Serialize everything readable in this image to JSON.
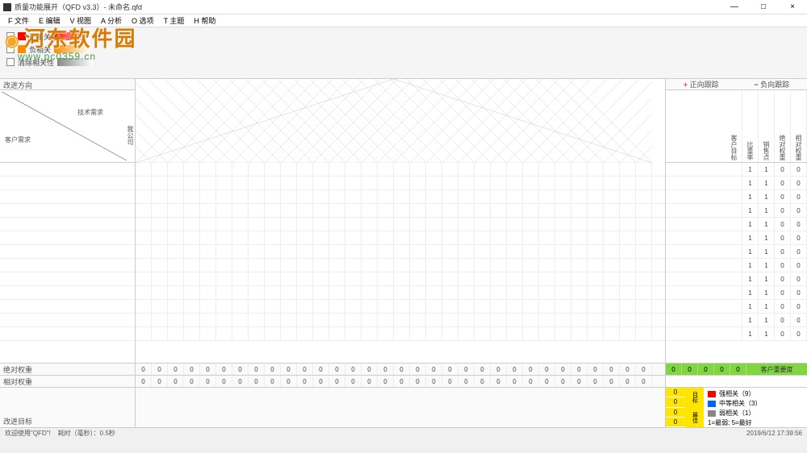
{
  "window": {
    "title": "质量功能展开（QFD  v3.3）- 未命名.qfd",
    "min": "—",
    "max": "□",
    "close": "×"
  },
  "menu": {
    "file": "F 文件",
    "edit": "E 编辑",
    "view": "V 视图",
    "analysis": "A 分析",
    "options": "O 选项",
    "theme": "T 主题",
    "help": "H 帮助"
  },
  "watermark": {
    "main": "河东软件园",
    "url": "www.pc0359.cn"
  },
  "toolbar": {
    "pos_corr": "正相关",
    "neg_corr": "负相关",
    "clear_corr": "清除相关性"
  },
  "left": {
    "improve_dir": "改进方向",
    "tech_req": "技术需求",
    "cust_req": "客户需求",
    "abs_weight": "绝对权重",
    "rel_weight": "相对权重",
    "improve_target": "改进目标"
  },
  "right": {
    "pos_track": "正向跟踪",
    "neg_track": "负向跟踪",
    "col1": "客户目标",
    "col2": "比重率",
    "col3": "销售点",
    "col4": "绝对权重",
    "col5": "相对权重",
    "customer_importance": "客户重要度",
    "data_rows": [
      [
        "1",
        "1",
        "0",
        "0"
      ],
      [
        "1",
        "1",
        "0",
        "0"
      ],
      [
        "1",
        "1",
        "0",
        "0"
      ],
      [
        "1",
        "1",
        "0",
        "0"
      ],
      [
        "1",
        "1",
        "0",
        "0"
      ],
      [
        "1",
        "1",
        "0",
        "0"
      ],
      [
        "1",
        "1",
        "0",
        "0"
      ],
      [
        "1",
        "1",
        "0",
        "0"
      ],
      [
        "1",
        "1",
        "0",
        "0"
      ],
      [
        "1",
        "1",
        "0",
        "0"
      ],
      [
        "1",
        "1",
        "0",
        "0"
      ],
      [
        "1",
        "1",
        "0",
        "0"
      ],
      [
        "1",
        "1",
        "0",
        "0"
      ]
    ],
    "yellow_vals": [
      "0",
      "0",
      "0",
      "0"
    ],
    "yellow_vert": [
      "目标",
      "最佳"
    ],
    "legend": {
      "strong": "强相关（9）",
      "medium": "中等相关（3）",
      "weak": "弱相关（1）",
      "scale": "1=最弱; 5=最好"
    }
  },
  "sums": {
    "zeros": "0"
  },
  "status": {
    "left": "欢迎使用\"QFD\"!",
    "mid": "耗时（毫秒）：0.5秒",
    "right": "2019/6/12  17:39:56"
  }
}
